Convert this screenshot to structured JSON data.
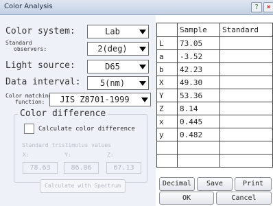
{
  "window": {
    "title": "Color Analysis",
    "help_icon": "help-icon",
    "close_icon": "close-icon"
  },
  "settings": {
    "color_system": {
      "label": "Color system:",
      "value": "Lab"
    },
    "standard_observers": {
      "label_line1": "Standard",
      "label_line2": "observers:",
      "value": "2(deg)"
    },
    "light_source": {
      "label": "Light source:",
      "value": "D65"
    },
    "data_interval": {
      "label": "Data interval:",
      "value": "5(nm)"
    },
    "color_matching": {
      "label_line1": "Color matching",
      "label_line2": "function:",
      "value": "JIS Z8701-1999"
    }
  },
  "color_difference": {
    "title": "Color difference",
    "checkbox_label": "Calculate color difference",
    "checked": false,
    "tristimulus_label": "Standard tristimulus values",
    "x_label": "X:",
    "y_label": "Y:",
    "z_label": "Z:",
    "x_value": "78.63",
    "y_value": "86.06",
    "z_value": "67.13",
    "spectrum_button": "Calculate with Spectrum"
  },
  "table": {
    "headers": [
      "",
      "Sample",
      "Standard"
    ],
    "rows": [
      [
        "L",
        "73.05",
        ""
      ],
      [
        "a",
        "-3.52",
        ""
      ],
      [
        "b",
        "42.23",
        ""
      ],
      [
        "X",
        "49.30",
        ""
      ],
      [
        "Y",
        "53.36",
        ""
      ],
      [
        "Z",
        "8.14",
        ""
      ],
      [
        "x",
        "0.445",
        ""
      ],
      [
        "y",
        "0.482",
        ""
      ],
      [
        "",
        "",
        ""
      ],
      [
        "",
        "",
        ""
      ]
    ]
  },
  "buttons": {
    "decimal": "Decimal",
    "save": "Save",
    "print": "Print",
    "ok": "OK",
    "cancel": "Cancel"
  }
}
